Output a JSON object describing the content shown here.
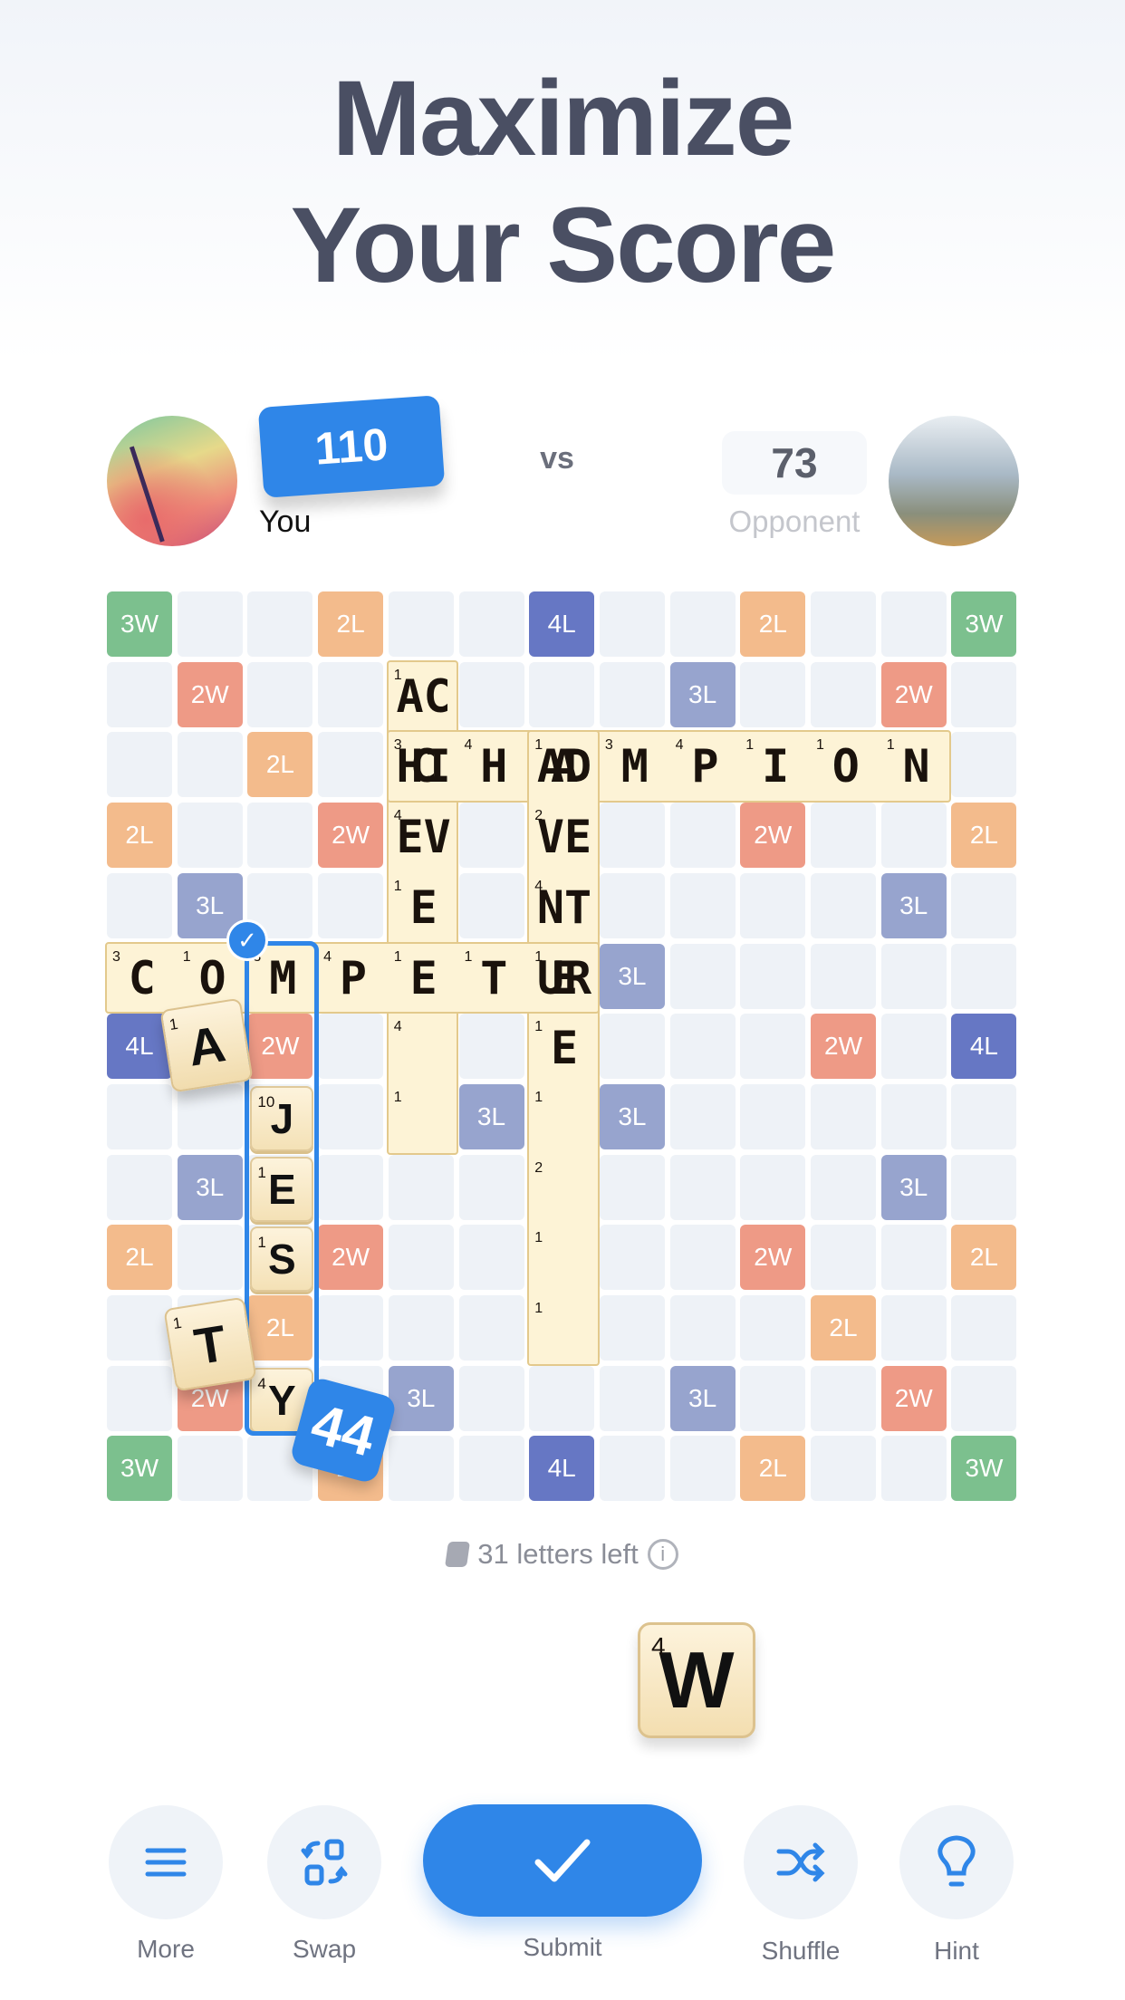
{
  "header": {
    "line1": "Maximize",
    "line2": "Your Score"
  },
  "players": {
    "you": {
      "name": "You",
      "score": "110",
      "avatar": "palm-beach-sunset"
    },
    "vs": "vs",
    "opponent": {
      "name": "Opponent",
      "score": "73",
      "avatar": "misty-mountains"
    }
  },
  "colors": {
    "3W": "#7cc08e",
    "2W": "#ee9a86",
    "2L": "#f3bb8c",
    "3L": "#97a4ce",
    "4L": "#6677c4",
    "accent": "#2f86e8",
    "tile": "#fdf3d6"
  },
  "board": {
    "size": 13,
    "premiums": [
      [
        0,
        0,
        "3W"
      ],
      [
        0,
        3,
        "2L"
      ],
      [
        0,
        6,
        "4L"
      ],
      [
        0,
        9,
        "2L"
      ],
      [
        0,
        12,
        "3W"
      ],
      [
        1,
        1,
        "2W"
      ],
      [
        1,
        8,
        "3L"
      ],
      [
        1,
        11,
        "2W"
      ],
      [
        2,
        2,
        "2L"
      ],
      [
        3,
        0,
        "2L"
      ],
      [
        3,
        3,
        "2W"
      ],
      [
        3,
        9,
        "2W"
      ],
      [
        3,
        12,
        "2L"
      ],
      [
        4,
        1,
        "3L"
      ],
      [
        4,
        11,
        "3L"
      ],
      [
        5,
        7,
        "3L"
      ],
      [
        6,
        0,
        "4L"
      ],
      [
        6,
        2,
        "2W"
      ],
      [
        6,
        10,
        "2W"
      ],
      [
        6,
        12,
        "4L"
      ],
      [
        7,
        5,
        "3L"
      ],
      [
        7,
        7,
        "3L"
      ],
      [
        8,
        1,
        "3L"
      ],
      [
        8,
        11,
        "3L"
      ],
      [
        9,
        0,
        "2L"
      ],
      [
        9,
        3,
        "2W"
      ],
      [
        9,
        9,
        "2W"
      ],
      [
        9,
        12,
        "2L"
      ],
      [
        10,
        2,
        "2L"
      ],
      [
        10,
        10,
        "2L"
      ],
      [
        11,
        1,
        "2W"
      ],
      [
        11,
        4,
        "3L"
      ],
      [
        11,
        8,
        "3L"
      ],
      [
        11,
        11,
        "2W"
      ],
      [
        12,
        0,
        "3W"
      ],
      [
        12,
        3,
        "2L"
      ],
      [
        12,
        6,
        "4L"
      ],
      [
        12,
        9,
        "2L"
      ],
      [
        12,
        12,
        "3W"
      ]
    ],
    "words": [
      {
        "word": "ACHIEVE",
        "row": 1,
        "col": 4,
        "dir": "down",
        "values": [
          1,
          3,
          4,
          1,
          1,
          4,
          1
        ]
      },
      {
        "word": "CHAMPION",
        "row": 2,
        "col": 4,
        "dir": "across",
        "values": [
          3,
          4,
          1,
          3,
          4,
          1,
          1,
          1
        ]
      },
      {
        "word": "ADVENTURE",
        "row": 2,
        "col": 6,
        "dir": "down",
        "values": [
          1,
          2,
          4,
          1,
          1,
          1,
          2,
          1,
          1
        ]
      },
      {
        "word": "COMPETE",
        "row": 5,
        "col": 0,
        "dir": "across",
        "values": [
          3,
          1,
          3,
          4,
          1,
          1,
          1
        ]
      }
    ],
    "new_tiles": [
      {
        "letter": "J",
        "value": "10",
        "row": 7,
        "col": 2
      },
      {
        "letter": "E",
        "value": "1",
        "row": 8,
        "col": 2
      },
      {
        "letter": "S",
        "value": "1",
        "row": 9,
        "col": 2
      },
      {
        "letter": "Y",
        "value": "4",
        "row": 11,
        "col": 2
      }
    ],
    "dragging_tiles": [
      {
        "letter": "A",
        "value": "1"
      },
      {
        "letter": "T",
        "value": "1"
      }
    ],
    "move_score": "44"
  },
  "letters_left": "31 letters left",
  "rack": [
    {
      "letter": "W",
      "value": "4"
    }
  ],
  "toolbar": {
    "more": "More",
    "swap": "Swap",
    "submit": "Submit",
    "shuffle": "Shuffle",
    "hint": "Hint"
  }
}
